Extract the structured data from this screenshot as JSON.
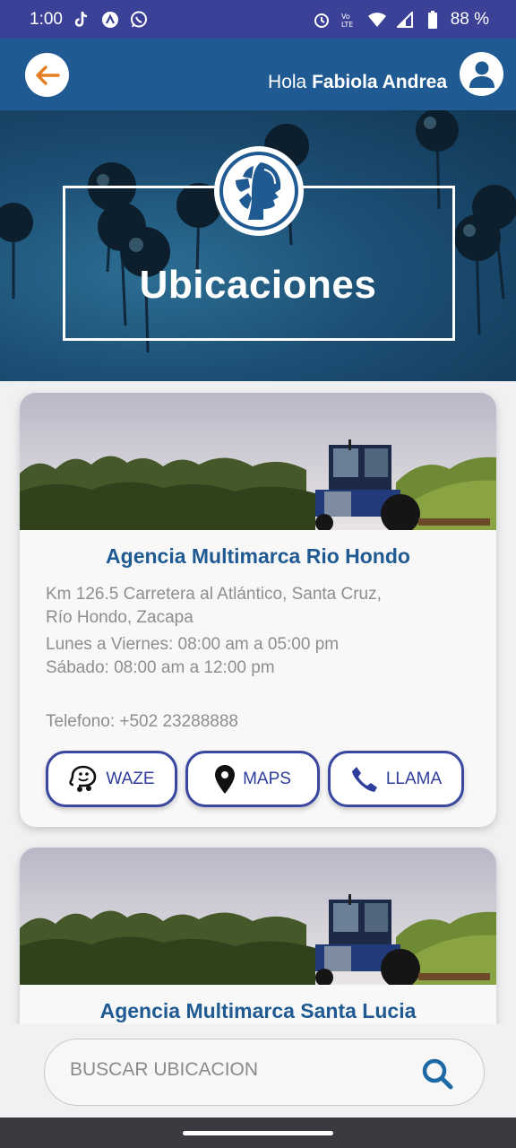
{
  "status_bar": {
    "time": "1:00",
    "battery": "88 %",
    "left_icons": [
      "tiktok-icon",
      "app-icon",
      "whatsapp-icon"
    ],
    "right_icons": [
      "alarm-icon",
      "volte-icon",
      "wifi-icon",
      "signal-icon",
      "battery-icon"
    ]
  },
  "header": {
    "greeting_prefix": "Hola",
    "user_name": "Fabiola Andrea",
    "back_icon": "arrow-left-icon",
    "avatar_icon": "user-icon"
  },
  "hero": {
    "title": "Ubicaciones"
  },
  "locations": [
    {
      "name": "Agencia Multimarca Rio Hondo",
      "address_line1": "Km 126.5 Carretera al Atlántico, Santa Cruz,",
      "address_line2": "Río Hondo, Zacapa",
      "hours_weekdays": "Lunes a Viernes: 08:00 am a 05:00 pm",
      "hours_saturday": "Sábado: 08:00 am a 12:00 pm",
      "phone": "Telefono: +502 23288888",
      "buttons": {
        "waze": "WAZE",
        "maps": "MAPS",
        "call": "LLAMA"
      }
    },
    {
      "name": "Agencia Multimarca Santa Lucia"
    }
  ],
  "search": {
    "placeholder": "BUSCAR UBICACION"
  },
  "colors": {
    "status_bar": "#3a4196",
    "header": "#1f5a92",
    "accent_orange": "#e67e22",
    "button_border": "#3947a0",
    "title_blue": "#1f5a92"
  }
}
